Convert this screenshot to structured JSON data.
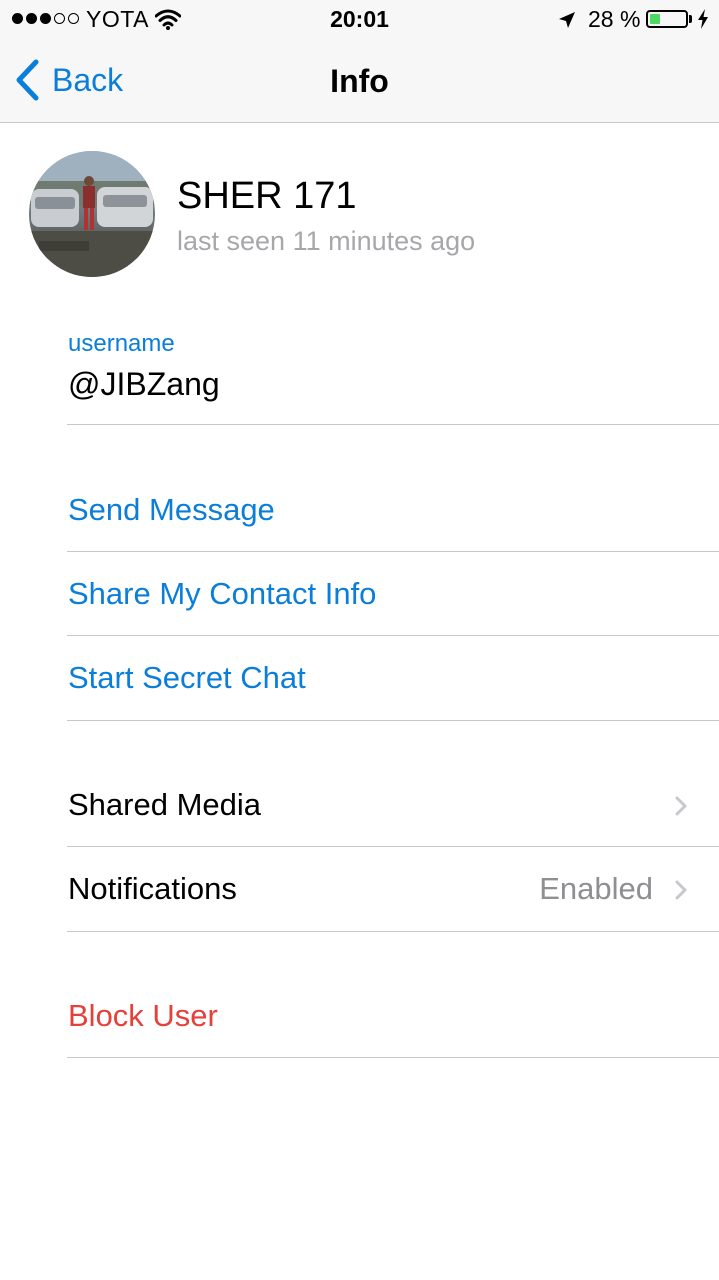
{
  "status_bar": {
    "signal_dots_filled": 3,
    "signal_dots_total": 5,
    "carrier": "YOTA",
    "time": "20:01",
    "battery_percent_text": "28 %",
    "battery_level": 0.28,
    "battery_color": "#4cd964"
  },
  "nav": {
    "back_label": "Back",
    "title": "Info"
  },
  "profile": {
    "name": "SHER 171",
    "last_seen": "last seen 11 minutes ago"
  },
  "username": {
    "label": "username",
    "value": "@JIBZang"
  },
  "actions": [
    {
      "label": "Send Message"
    },
    {
      "label": "Share My Contact Info"
    },
    {
      "label": "Start Secret Chat"
    }
  ],
  "settings": [
    {
      "label": "Shared Media",
      "value": ""
    },
    {
      "label": "Notifications",
      "value": "Enabled"
    }
  ],
  "danger": {
    "block_label": "Block User"
  },
  "colors": {
    "accent": "#0a7ed8",
    "destructive": "#e5413b",
    "secondary_text": "#8e8e93",
    "separator": "#c8c7cc"
  },
  "icons": [
    "wifi-icon",
    "location-arrow-icon",
    "battery-icon",
    "charging-bolt-icon",
    "back-chevron-icon",
    "chevron-right-icon"
  ]
}
